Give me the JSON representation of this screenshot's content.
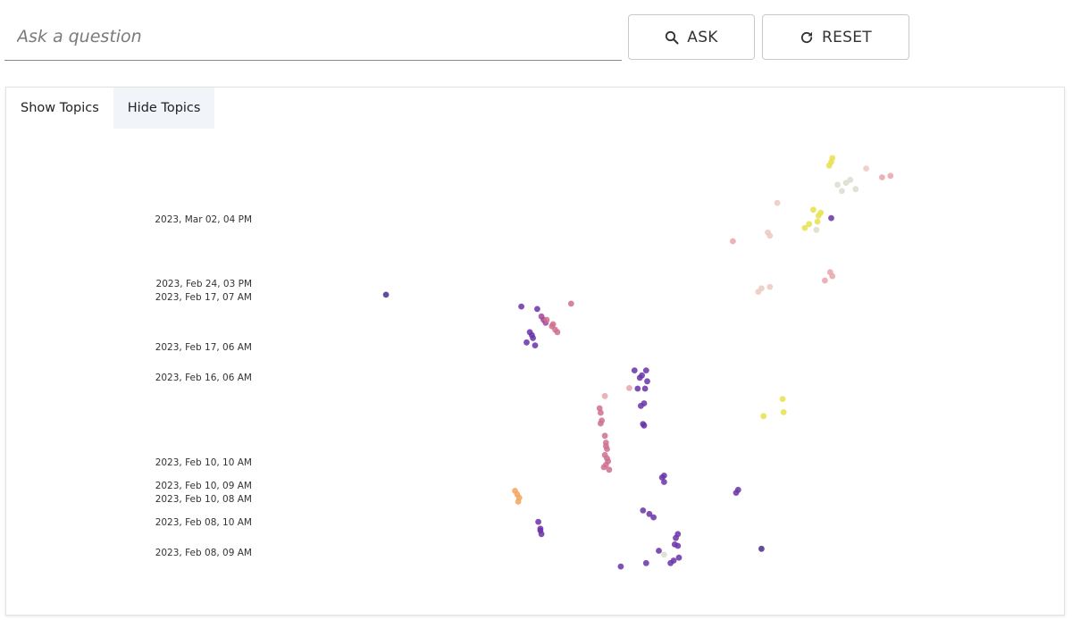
{
  "search": {
    "placeholder": "Ask a question",
    "value": ""
  },
  "buttons": {
    "ask": {
      "label": "ASK",
      "icon": "search-icon"
    },
    "reset": {
      "label": "RESET",
      "icon": "refresh-icon"
    }
  },
  "tabs": [
    {
      "label": "Show Topics",
      "active": true
    },
    {
      "label": "Hide Topics",
      "active": false
    }
  ],
  "chart_data": {
    "type": "scatter",
    "title": "",
    "xlabel": "",
    "ylabel": "",
    "grid": false,
    "legend": "none",
    "y_tick_labels": [
      "2023, Mar 02, 04 PM",
      "2023, Feb 24, 03 PM",
      "2023, Feb 17, 07 AM",
      "2023, Feb 17, 06 AM",
      "2023, Feb 16, 06 AM",
      "2023, Feb 10, 10 AM",
      "2023, Feb 10, 09 AM",
      "2023, Feb 10, 08 AM",
      "2023, Feb 08, 10 AM",
      "2023, Feb 08, 09 AM"
    ],
    "xlim": [
      0,
      1
    ],
    "ylim": [
      0,
      1
    ],
    "colors": {
      "dark_purple": "#4a2b8c",
      "purple": "#6a33a8",
      "magenta": "#a2479c",
      "pink": "#cf6f8e",
      "light_pink": "#e9a6aa",
      "pale": "#ecc9c0",
      "orange": "#f2a55e",
      "yellow": "#e8e04c",
      "gray": "#dcdcd0"
    },
    "series": [
      {
        "color": "dark_purple",
        "points": [
          [
            0.359,
            0.651
          ],
          [
            0.714,
            0.134
          ]
        ]
      },
      {
        "color": "purple",
        "points": [
          [
            0.502,
            0.622
          ],
          [
            0.487,
            0.627
          ],
          [
            0.492,
            0.554
          ],
          [
            0.497,
            0.569
          ],
          [
            0.498,
            0.563
          ],
          [
            0.5,
            0.548
          ],
          [
            0.495,
            0.575
          ],
          [
            0.594,
            0.497
          ],
          [
            0.605,
            0.497
          ],
          [
            0.597,
            0.46
          ],
          [
            0.604,
            0.46
          ],
          [
            0.606,
            0.475
          ],
          [
            0.599,
            0.482
          ],
          [
            0.601,
            0.487
          ],
          [
            0.603,
            0.43
          ],
          [
            0.6,
            0.425
          ],
          [
            0.603,
            0.385
          ],
          [
            0.602,
            0.388
          ],
          [
            0.622,
            0.283
          ],
          [
            0.622,
            0.27
          ],
          [
            0.62,
            0.279
          ],
          [
            0.602,
            0.212
          ],
          [
            0.608,
            0.205
          ],
          [
            0.612,
            0.198
          ],
          [
            0.503,
            0.189
          ],
          [
            0.505,
            0.175
          ],
          [
            0.506,
            0.164
          ],
          [
            0.505,
            0.171
          ],
          [
            0.635,
            0.164
          ],
          [
            0.633,
            0.156
          ],
          [
            0.632,
            0.143
          ],
          [
            0.635,
            0.14
          ],
          [
            0.636,
            0.116
          ],
          [
            0.631,
            0.11
          ],
          [
            0.628,
            0.105
          ],
          [
            0.617,
            0.13
          ],
          [
            0.605,
            0.105
          ],
          [
            0.581,
            0.098
          ],
          [
            0.692,
            0.254
          ],
          [
            0.69,
            0.248
          ],
          [
            0.78,
            0.807
          ]
        ]
      },
      {
        "color": "magenta",
        "points": [
          [
            0.506,
            0.607
          ],
          [
            0.51,
            0.594
          ],
          [
            0.508,
            0.6
          ]
        ]
      },
      {
        "color": "pink",
        "points": [
          [
            0.534,
            0.633
          ],
          [
            0.511,
            0.6
          ],
          [
            0.516,
            0.587
          ],
          [
            0.519,
            0.58
          ],
          [
            0.521,
            0.575
          ],
          [
            0.517,
            0.591
          ],
          [
            0.561,
            0.42
          ],
          [
            0.562,
            0.411
          ],
          [
            0.563,
            0.395
          ],
          [
            0.562,
            0.389
          ],
          [
            0.566,
            0.364
          ],
          [
            0.567,
            0.35
          ],
          [
            0.567,
            0.343
          ],
          [
            0.568,
            0.337
          ],
          [
            0.566,
            0.325
          ],
          [
            0.568,
            0.318
          ],
          [
            0.569,
            0.312
          ],
          [
            0.567,
            0.305
          ],
          [
            0.565,
            0.3
          ],
          [
            0.57,
            0.295
          ]
        ]
      },
      {
        "color": "light_pink",
        "points": [
          [
            0.687,
            0.76
          ],
          [
            0.828,
            0.89
          ],
          [
            0.836,
            0.893
          ],
          [
            0.779,
            0.697
          ],
          [
            0.774,
            0.68
          ],
          [
            0.781,
            0.689
          ],
          [
            0.589,
            0.461
          ],
          [
            0.566,
            0.445
          ]
        ]
      },
      {
        "color": "pale",
        "points": [
          [
            0.729,
            0.838
          ],
          [
            0.722,
            0.771
          ],
          [
            0.72,
            0.778
          ],
          [
            0.714,
            0.664
          ],
          [
            0.722,
            0.667
          ],
          [
            0.711,
            0.657
          ],
          [
            0.813,
            0.908
          ]
        ]
      },
      {
        "color": "orange",
        "points": [
          [
            0.481,
            0.252
          ],
          [
            0.483,
            0.245
          ],
          [
            0.485,
            0.238
          ],
          [
            0.484,
            0.23
          ]
        ]
      },
      {
        "color": "yellow",
        "points": [
          [
            0.781,
            0.929
          ],
          [
            0.778,
            0.914
          ],
          [
            0.78,
            0.921
          ],
          [
            0.763,
            0.824
          ],
          [
            0.759,
            0.795
          ],
          [
            0.755,
            0.787
          ],
          [
            0.767,
            0.8
          ],
          [
            0.768,
            0.812
          ],
          [
            0.77,
            0.818
          ],
          [
            0.735,
            0.412
          ],
          [
            0.734,
            0.439
          ],
          [
            0.716,
            0.404
          ]
        ]
      },
      {
        "color": "gray",
        "points": [
          [
            0.79,
            0.862
          ],
          [
            0.786,
            0.875
          ],
          [
            0.794,
            0.879
          ],
          [
            0.798,
            0.885
          ],
          [
            0.803,
            0.866
          ],
          [
            0.766,
            0.783
          ],
          [
            0.622,
            0.122
          ]
        ]
      }
    ]
  }
}
